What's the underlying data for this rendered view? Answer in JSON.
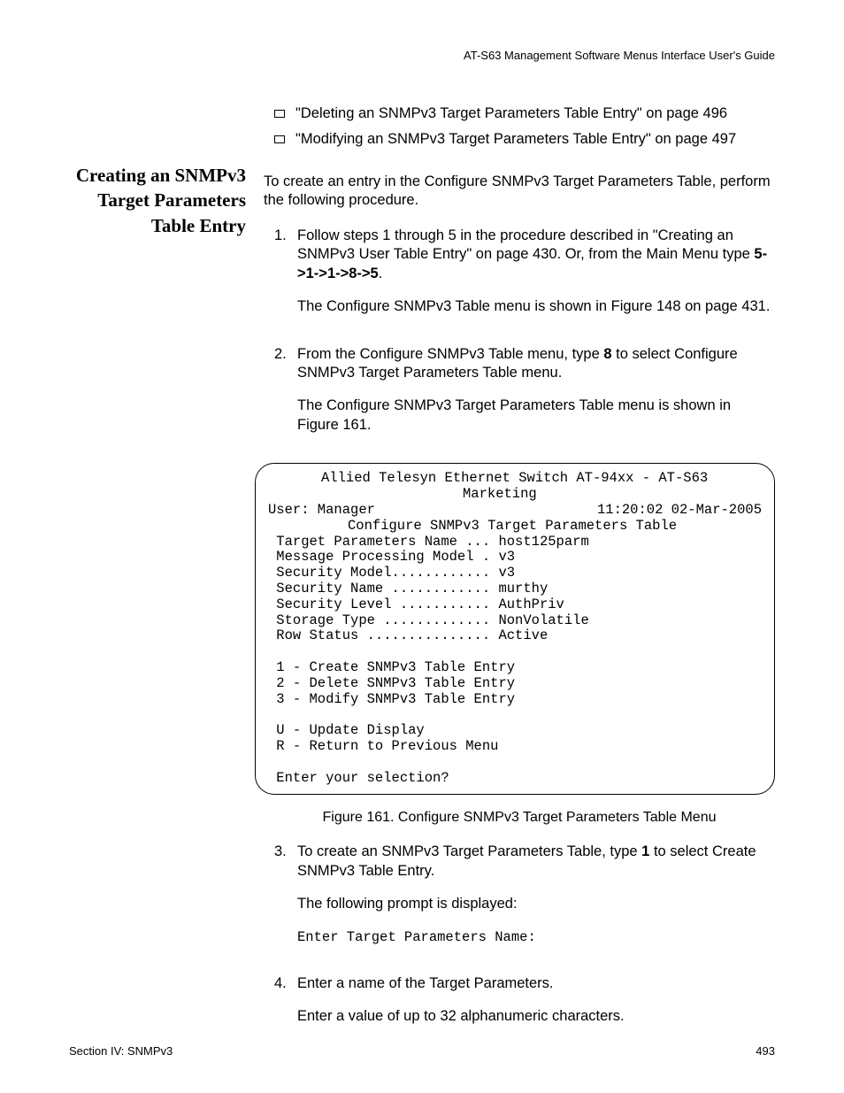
{
  "header": {
    "guide_title": "AT-S63 Management Software Menus Interface User's Guide"
  },
  "bullets": [
    "\"Deleting an SNMPv3 Target Parameters Table Entry\" on page 496",
    "\"Modifying an SNMPv3 Target Parameters Table Entry\" on page 497"
  ],
  "sidebar": {
    "title": "Creating an SNMPv3 Target Parameters Table Entry"
  },
  "intro": "To create an entry in the Configure SNMPv3 Target Parameters Table, perform the following procedure.",
  "steps": {
    "s1": {
      "num": "1.",
      "text_a": "Follow steps 1 through 5 in the procedure described in \"Creating an SNMPv3 User Table Entry\" on page 430. Or, from the Main Menu type ",
      "menu_path": "5->1->1->8->5",
      "text_b": ".",
      "after": "The Configure SNMPv3 Table menu is shown in Figure 148 on page 431."
    },
    "s2": {
      "num": "2.",
      "text_a": "From the Configure SNMPv3 Table menu, type ",
      "bold": "8",
      "text_b": " to select Configure SNMPv3 Target Parameters Table menu.",
      "after": "The Configure SNMPv3 Target Parameters Table menu is shown in Figure 161."
    },
    "s3": {
      "num": "3.",
      "text_a": "To create an SNMPv3 Target Parameters Table, type ",
      "bold": "1",
      "text_b": " to select Create SNMPv3 Table Entry.",
      "after": "The following prompt is displayed:",
      "prompt": "Enter Target Parameters Name:"
    },
    "s4": {
      "num": "4.",
      "text": "Enter a name of the Target Parameters.",
      "after": "Enter a value of up to 32 alphanumeric characters."
    }
  },
  "terminal": {
    "title_line1": "Allied Telesyn Ethernet Switch AT-94xx - AT-S63",
    "title_line2": "Marketing",
    "user": "User: Manager",
    "timestamp": "11:20:02 02-Mar-2005",
    "menu_title": "Configure SNMPv3 Target Parameters Table",
    "rows": [
      " Target Parameters Name ... host125parm",
      " Message Processing Model . v3",
      " Security Model............ v3",
      " Security Name ............ murthy",
      " Security Level ........... AuthPriv",
      " Storage Type ............. NonVolatile",
      " Row Status ............... Active"
    ],
    "options": [
      " 1 - Create SNMPv3 Table Entry",
      " 2 - Delete SNMPv3 Table Entry",
      " 3 - Modify SNMPv3 Table Entry"
    ],
    "nav": [
      " U - Update Display",
      " R - Return to Previous Menu"
    ],
    "prompt": " Enter your selection?"
  },
  "figure_caption": "Figure 161. Configure SNMPv3 Target Parameters Table Menu",
  "footer": {
    "left": "Section IV: SNMPv3",
    "right": "493"
  }
}
